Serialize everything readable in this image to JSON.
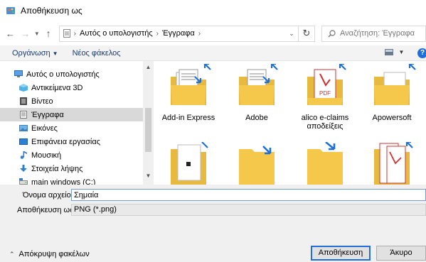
{
  "window": {
    "title": "Αποθήκευση ως"
  },
  "nav": {
    "breadcrumbs": [
      "Αυτός ο υπολογιστής",
      "Έγγραφα"
    ],
    "search_placeholder": "Αναζήτηση: Έγγραφα"
  },
  "toolbar": {
    "organize_label": "Οργάνωση",
    "new_folder_label": "Νέος φάκελος"
  },
  "sidebar": {
    "items": [
      {
        "label": "Αυτός ο υπολογιστής",
        "icon": "computer-icon"
      },
      {
        "label": "Αντικείμενα 3D",
        "icon": "cube-icon"
      },
      {
        "label": "Βίντεο",
        "icon": "video-icon"
      },
      {
        "label": "Έγγραφα",
        "icon": "document-icon",
        "selected": true
      },
      {
        "label": "Εικόνες",
        "icon": "pictures-icon"
      },
      {
        "label": "Επιφάνεια εργασίας",
        "icon": "desktop-icon"
      },
      {
        "label": "Μουσική",
        "icon": "music-icon"
      },
      {
        "label": "Στοιχεία λήψης",
        "icon": "download-icon"
      },
      {
        "label": "main windows (C:)",
        "icon": "drive-icon"
      }
    ]
  },
  "files": {
    "items": [
      {
        "label": "Add-in Express",
        "icon": "folder-docs-icon"
      },
      {
        "label": "Adobe",
        "icon": "folder-docs-icon"
      },
      {
        "label": "alico e-claims αποδείξεις",
        "icon": "folder-pdf-icon"
      },
      {
        "label": "Apowersoft",
        "icon": "folder-icon"
      },
      {
        "label": "",
        "icon": "folder-icon"
      },
      {
        "label": "",
        "icon": "folder-icon"
      },
      {
        "label": "",
        "icon": "folder-icon"
      },
      {
        "label": "",
        "icon": "folder-pdf-icon"
      }
    ]
  },
  "form": {
    "filename_label": "Όνομα αρχείου:",
    "filename_value": "Σημαία",
    "filetype_label": "Αποθήκευση ως:",
    "filetype_value": "PNG (*.png)"
  },
  "footer": {
    "hide_folders_label": "Απόκρυψη φακέλων",
    "save_label": "Αποθήκευση",
    "cancel_label": "Άκυρο"
  },
  "colors": {
    "accent": "#1e6fd9",
    "folder": "#f5c84c",
    "pdf_red": "#d32f2f"
  }
}
